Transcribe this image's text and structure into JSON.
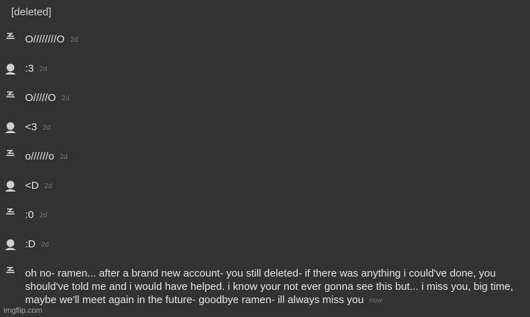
{
  "header": {
    "title": "[deleted]"
  },
  "messages": [
    {
      "avatar": "glitch-icon",
      "text": "O////////O",
      "time": "2d"
    },
    {
      "avatar": "person-icon",
      "text": ":3",
      "time": "2d"
    },
    {
      "avatar": "glitch-icon",
      "text": "O/////O",
      "time": "2d"
    },
    {
      "avatar": "person-icon",
      "text": "<3",
      "time": "2d"
    },
    {
      "avatar": "glitch-icon",
      "text": "o//////o",
      "time": "2d"
    },
    {
      "avatar": "person-icon",
      "text": "<D",
      "time": "2d"
    },
    {
      "avatar": "glitch-icon",
      "text": ":0",
      "time": "2d"
    },
    {
      "avatar": "person-icon",
      "text": ":D",
      "time": "2d"
    },
    {
      "avatar": "glitch-icon",
      "text": "oh no- ramen... after a brand new account- you still deleted- if there was anything i could've done, you should've told me and i would have helped. i know your not ever gonna see this but... i miss you, big time, maybe we'll meet again in the future- goodbye ramen- ill always miss you",
      "time": "now"
    }
  ],
  "watermark": "imgflip.com",
  "colors": {
    "background": "#323232",
    "text": "#e6e6e6",
    "timestamp": "#767676",
    "avatar": "#d0d0d0"
  }
}
